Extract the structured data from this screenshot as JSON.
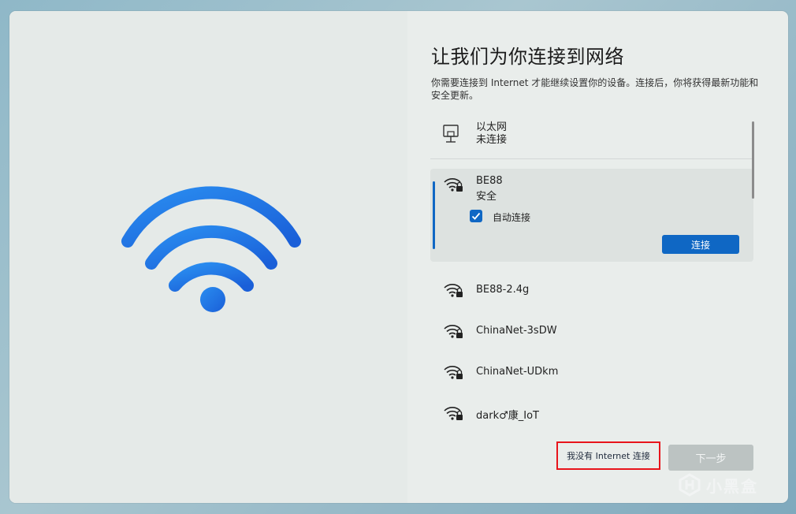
{
  "page": {
    "title": "让我们为你连接到网络",
    "description": "你需要连接到 Internet 才能继续设置你的设备。连接后，你将获得最新功能和安全更新。"
  },
  "ethernet": {
    "name": "以太网",
    "status": "未连接",
    "icon": "ethernet-icon"
  },
  "networks": [
    {
      "name": "BE88",
      "security": "安全",
      "auto_connect_label": "自动连接",
      "auto_connect": true,
      "connect_label": "连接",
      "icon": "wifi-lock-icon"
    },
    {
      "name": "BE88-2.4g",
      "icon": "wifi-lock-icon"
    },
    {
      "name": "ChinaNet-3sDW",
      "icon": "wifi-lock-icon"
    },
    {
      "name": "ChinaNet-UDkm",
      "icon": "wifi-lock-icon"
    },
    {
      "name": "dark♂康_IoT",
      "icon": "wifi-lock-icon"
    }
  ],
  "footer": {
    "no_internet_label": "我没有 Internet 连接",
    "next_label": "下一步"
  },
  "watermark": {
    "text": "小黑盒"
  },
  "colors": {
    "accent": "#0f67c4",
    "highlight_border": "#e8141b",
    "background": "#e9edeb"
  }
}
